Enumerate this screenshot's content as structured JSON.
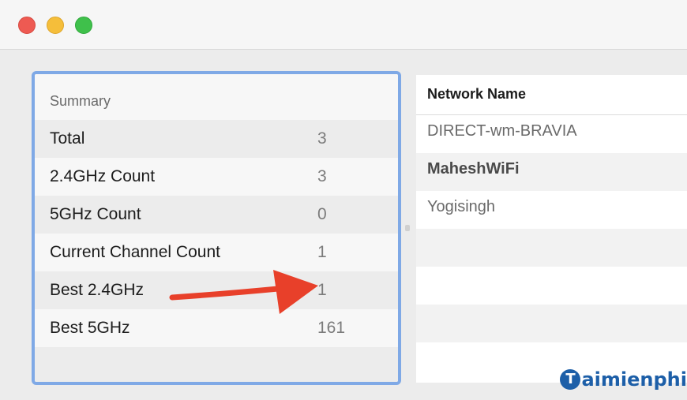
{
  "window": {
    "controls": [
      "close",
      "minimize",
      "maximize"
    ]
  },
  "summary": {
    "header": "Summary",
    "rows": [
      {
        "label": "Total",
        "value": "3"
      },
      {
        "label": "2.4GHz Count",
        "value": "3"
      },
      {
        "label": "5GHz Count",
        "value": "0"
      },
      {
        "label": "Current Channel Count",
        "value": "1"
      },
      {
        "label": "Best 2.4GHz",
        "value": "1"
      },
      {
        "label": "Best 5GHz",
        "value": "161"
      }
    ]
  },
  "networks": {
    "header": "Network Name",
    "rows": [
      {
        "name": "DIRECT-wm-BRAVIA"
      },
      {
        "name": "MaheshWiFi"
      },
      {
        "name": "Yogisingh"
      }
    ]
  },
  "annotation": {
    "arrow_color": "#e8402a",
    "points_to": "Best 2.4GHz value"
  },
  "watermark": {
    "logo_letter": "T",
    "text": "aimienphi"
  },
  "colors": {
    "focus_border": "#7fa9e6",
    "close": "#ee5a52",
    "minimize": "#f5be3a",
    "maximize": "#3fc04b"
  }
}
